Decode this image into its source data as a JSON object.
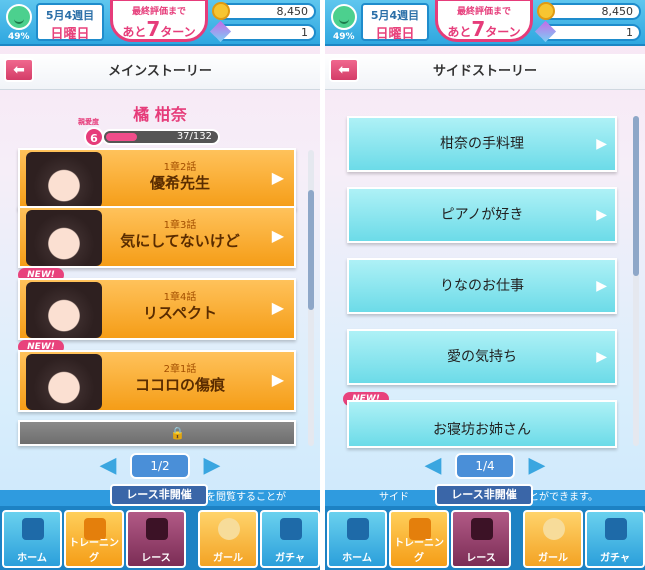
{
  "status": {
    "week": "5月4週目",
    "day": "日曜日",
    "mood_pct": "49%",
    "eval_line1": "最終評価まで",
    "eval_prefix": "あと",
    "eval_num": "7",
    "eval_suffix": "ターン",
    "coins": "8,450",
    "gems": "1"
  },
  "left": {
    "title": "メインストーリー",
    "character": "橘 柑奈",
    "affection_label": "親愛度",
    "affection_level": "6",
    "affection_text": "37/132",
    "affection_fraction": 0.28,
    "cards": [
      {
        "chapter": "1章2話",
        "title": "優希先生"
      },
      {
        "chapter": "1章3話",
        "title": "気にしてないけど"
      },
      {
        "chapter": "1章4話",
        "title": "リスペクト"
      },
      {
        "chapter": "2章1話",
        "title": "ココロの傷痕"
      }
    ],
    "new_label": "NEW!",
    "page": "1/2",
    "tip": "リーを閲覧することが"
  },
  "right": {
    "title": "サイドストーリー",
    "cards": [
      "柑奈の手料理",
      "ピアノが好き",
      "りなのお仕事",
      "愛の気持ち",
      "お寝坊お姉さん"
    ],
    "new_label": "NEW!",
    "page": "1/4",
    "tip_prefix": "サイド",
    "tip": "ることができます。"
  },
  "race_off": "レース非開催",
  "nav": [
    "ホーム",
    "トレーニング",
    "レース",
    "ガール",
    "ガチャ"
  ],
  "colors": {
    "accent": "#e63c7a",
    "primary": "#2fa7e0"
  }
}
